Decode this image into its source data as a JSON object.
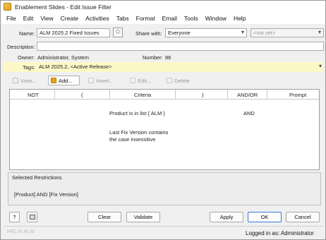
{
  "window": {
    "title": "Enablement Slides - Edit Issue Filter"
  },
  "menu": [
    "File",
    "Edit",
    "View",
    "Create",
    "Activities",
    "Tabs",
    "Format",
    "Email",
    "Tools",
    "Window",
    "Help"
  ],
  "form": {
    "name_label": "Name:",
    "name_value": "ALM 2025.2 Fixed Issues",
    "share_label": "Share with:",
    "share_value": "Everyone",
    "notset_value": "<not set>",
    "description_label": "Description:",
    "description_value": "",
    "owner_label": "Owner:",
    "owner_value": "Administrator, System",
    "number_label": "Number:",
    "number_value": "86",
    "tags_label": "Tags:",
    "tags_value": "ALM 2025.2, <Active Release>"
  },
  "toolbar": {
    "view": "View...",
    "add": "Add...",
    "insert": "Insert...",
    "edit": "Edit...",
    "delete": "Delete"
  },
  "grid": {
    "columns": [
      "NOT",
      "(",
      "Criteria",
      ")",
      "AND/OR",
      "Prompt"
    ],
    "rows": [
      {
        "criteria": "Product is in list { ALM }",
        "andor": "AND"
      },
      {
        "criteria_line1": "Last Fix Version contains",
        "criteria_line2": "the case insensitive"
      }
    ]
  },
  "restrictions": {
    "title": "Selected Restrictions",
    "text": "[Product]  AND  [Fix Version]"
  },
  "buttons": {
    "help": "?",
    "clear": "Clear",
    "validate": "Validate",
    "apply": "Apply",
    "ok": "OK",
    "cancel": "Cancel"
  },
  "status": {
    "logged_in": "Logged in as: Administrator"
  },
  "brand": "HELIX ALM",
  "colors": {
    "tags_highlight": "#fdf9c6",
    "ok_border": "#3a78d8",
    "add_icon": "#e8a318"
  }
}
